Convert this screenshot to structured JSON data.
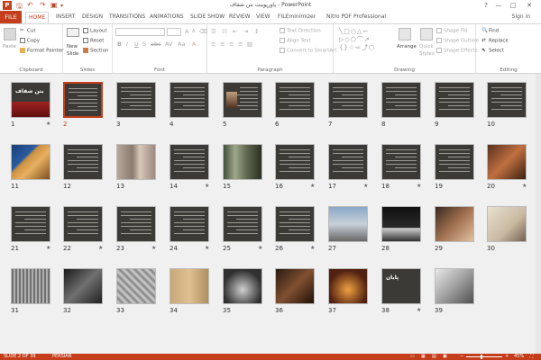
{
  "window": {
    "title": "پاورپوینت بتن شفاف - PowerPoint",
    "signin": "Sign in",
    "minimize": "—",
    "maximize": "□",
    "close": "✕",
    "help": "?"
  },
  "tabs": {
    "file": "FILE",
    "home": "HOME",
    "items": [
      "INSERT",
      "DESIGN",
      "TRANSITIONS",
      "ANIMATIONS",
      "SLIDE SHOW",
      "REVIEW",
      "VIEW",
      "FILEminimizer",
      "Nitro PDF Professional"
    ]
  },
  "ribbon": {
    "clipboard": {
      "label": "Clipboard",
      "paste": "Paste",
      "cut": "Cut",
      "copy": "Copy",
      "format_painter": "Format Painter"
    },
    "slides": {
      "label": "Slides",
      "new_slide": "New",
      "new_slide2": "Slide",
      "layout": "Layout",
      "reset": "Reset",
      "section": "Section"
    },
    "font": {
      "label": "Font"
    },
    "paragraph": {
      "label": "Paragraph",
      "text_direction": "Text Direction",
      "align_text": "Align Text",
      "convert": "Convert to SmartArt"
    },
    "drawing": {
      "label": "Drawing",
      "arrange": "Arrange",
      "quick_styles": "Quick",
      "quick_styles2": "Styles",
      "shape_fill": "Shape Fill",
      "shape_outline": "Shape Outline",
      "shape_effects": "Shape Effects"
    },
    "editing": {
      "label": "Editing",
      "find": "Find",
      "replace": "Replace",
      "select": "Select"
    }
  },
  "slides": [
    {
      "n": "1",
      "type": "title",
      "star": true
    },
    {
      "n": "2",
      "type": "dark",
      "star": false,
      "selected": true
    },
    {
      "n": "3",
      "type": "dark",
      "star": false
    },
    {
      "n": "4",
      "type": "dark",
      "star": false
    },
    {
      "n": "5",
      "type": "dark-person",
      "star": false
    },
    {
      "n": "6",
      "type": "dark",
      "star": false
    },
    {
      "n": "7",
      "type": "dark",
      "star": false
    },
    {
      "n": "8",
      "type": "dark",
      "star": false
    },
    {
      "n": "9",
      "type": "dark",
      "star": false
    },
    {
      "n": "10",
      "type": "dark",
      "star": false
    },
    {
      "n": "11",
      "type": "photo-building",
      "star": false
    },
    {
      "n": "12",
      "type": "dark",
      "star": false
    },
    {
      "n": "13",
      "type": "photo-light",
      "star": false
    },
    {
      "n": "14",
      "type": "dark",
      "star": true
    },
    {
      "n": "15",
      "type": "photo-green",
      "star": false
    },
    {
      "n": "16",
      "type": "dark",
      "star": true
    },
    {
      "n": "17",
      "type": "dark",
      "star": true
    },
    {
      "n": "18",
      "type": "dark",
      "star": true
    },
    {
      "n": "19",
      "type": "dark",
      "star": false
    },
    {
      "n": "20",
      "type": "photo-warm",
      "star": true
    },
    {
      "n": "21",
      "type": "dark",
      "star": true
    },
    {
      "n": "22",
      "type": "dark",
      "star": true
    },
    {
      "n": "23",
      "type": "dark",
      "star": true
    },
    {
      "n": "24",
      "type": "dark",
      "star": true
    },
    {
      "n": "25",
      "type": "dark",
      "star": true
    },
    {
      "n": "26",
      "type": "dark",
      "star": true
    },
    {
      "n": "27",
      "type": "photo-building2",
      "star": false
    },
    {
      "n": "28",
      "type": "photo-darkbox",
      "star": false
    },
    {
      "n": "29",
      "type": "photo-interior",
      "star": false
    },
    {
      "n": "30",
      "type": "photo-pale",
      "star": false
    },
    {
      "n": "31",
      "type": "photo-grid",
      "star": false
    },
    {
      "n": "32",
      "type": "photo-dark2",
      "star": false
    },
    {
      "n": "33",
      "type": "photo-glass",
      "star": false
    },
    {
      "n": "34",
      "type": "photo-wood",
      "star": false
    },
    {
      "n": "35",
      "type": "photo-hall",
      "star": false
    },
    {
      "n": "36",
      "type": "photo-stairs",
      "star": false
    },
    {
      "n": "37",
      "type": "photo-orange",
      "star": false
    },
    {
      "n": "38",
      "type": "end",
      "star": true
    },
    {
      "n": "39",
      "type": "photo-laptop",
      "star": false
    }
  ],
  "title_slide_text": "بتن شفاف",
  "end_slide_text": "پایان",
  "status": {
    "slide": "SLIDE 2 OF 39",
    "lang": "PERSIAN",
    "zoom": "45%"
  },
  "colors": {
    "accent": "#c43e1c"
  }
}
